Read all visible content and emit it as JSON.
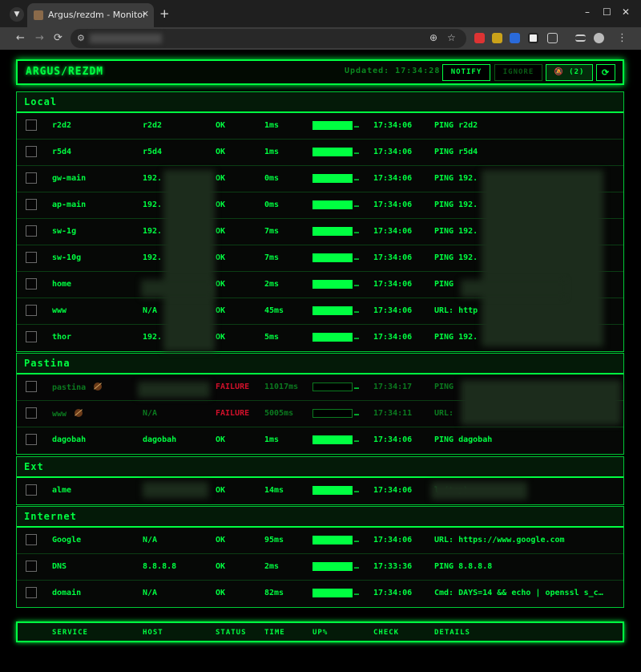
{
  "browser": {
    "tab_list_icon": "chevron-down-icon",
    "tab_title": "Argus/rezdm - Monitor",
    "tab_close": "✕",
    "new_tab": "+",
    "window": {
      "minimize": "–",
      "maximize": "☐",
      "close": "✕"
    },
    "nav": {
      "back": "←",
      "forward": "→",
      "reload": "⟳"
    }
  },
  "header": {
    "title": "ARGUS/REZDM",
    "updated": "Updated: 17:34:28",
    "notify_label": "NOTIFY",
    "ignore_label": "IGNORE",
    "muted_label": "🔕 (2)",
    "refresh_label": "⟳"
  },
  "colors": {
    "accent": "#00ff41",
    "failure": "#d0102a"
  },
  "groups": [
    {
      "name": "Local",
      "rows": [
        {
          "service": "r2d2",
          "host": "r2d2",
          "status": "OK",
          "time": "1ms",
          "up": 100,
          "check": "17:34:06",
          "details": "PING r2d2"
        },
        {
          "service": "r5d4",
          "host": "r5d4",
          "status": "OK",
          "time": "1ms",
          "up": 100,
          "check": "17:34:06",
          "details": "PING r5d4"
        },
        {
          "service": "gw-main",
          "host": "192.",
          "status": "OK",
          "time": "0ms",
          "up": 100,
          "check": "17:34:06",
          "details": "PING 192."
        },
        {
          "service": "ap-main",
          "host": "192.",
          "status": "OK",
          "time": "0ms",
          "up": 100,
          "check": "17:34:06",
          "details": "PING 192."
        },
        {
          "service": "sw-1g",
          "host": "192.",
          "status": "OK",
          "time": "7ms",
          "up": 100,
          "check": "17:34:06",
          "details": "PING 192."
        },
        {
          "service": "sw-10g",
          "host": "192.",
          "status": "OK",
          "time": "7ms",
          "up": 100,
          "check": "17:34:06",
          "details": "PING 192."
        },
        {
          "service": "home",
          "host": "",
          "status": "OK",
          "time": "2ms",
          "up": 100,
          "check": "17:34:06",
          "details": "PING"
        },
        {
          "service": "www",
          "host": "N/A",
          "status": "OK",
          "time": "45ms",
          "up": 100,
          "check": "17:34:06",
          "details": "URL: http"
        },
        {
          "service": "thor",
          "host": "192.",
          "status": "OK",
          "time": "5ms",
          "up": 100,
          "check": "17:34:06",
          "details": "PING 192."
        }
      ]
    },
    {
      "name": "Pastina",
      "rows": [
        {
          "service": "pastina",
          "host": "",
          "status": "FAILURE",
          "time": "11017ms",
          "up": 0,
          "check": "17:34:17",
          "details": "PING",
          "muted": true
        },
        {
          "service": "www",
          "host": "N/A",
          "status": "FAILURE",
          "time": "5005ms",
          "up": 0,
          "check": "17:34:11",
          "details": "URL:",
          "muted": true
        },
        {
          "service": "dagobah",
          "host": "dagobah",
          "status": "OK",
          "time": "1ms",
          "up": 100,
          "check": "17:34:06",
          "details": "PING dagobah"
        }
      ]
    },
    {
      "name": "Ext",
      "rows": [
        {
          "service": "alme",
          "host": "",
          "status": "OK",
          "time": "14ms",
          "up": 100,
          "check": "17:34:06",
          "details": "l (tcp)"
        }
      ]
    },
    {
      "name": "Internet",
      "rows": [
        {
          "service": "Google",
          "host": "N/A",
          "status": "OK",
          "time": "95ms",
          "up": 100,
          "check": "17:34:06",
          "details": "URL: https://www.google.com"
        },
        {
          "service": "DNS",
          "host": "8.8.8.8",
          "status": "OK",
          "time": "2ms",
          "up": 100,
          "check": "17:33:36",
          "details": "PING 8.8.8.8"
        },
        {
          "service": "domain",
          "host": "N/A",
          "status": "OK",
          "time": "82ms",
          "up": 100,
          "check": "17:34:06",
          "details": "Cmd: DAYS=14 && echo | openssl s_c…"
        }
      ]
    }
  ],
  "footer": {
    "service": "SERVICE",
    "host": "HOST",
    "status": "STATUS",
    "time": "TIME",
    "up": "UP%",
    "check": "CHECK",
    "details": "DETAILS"
  }
}
